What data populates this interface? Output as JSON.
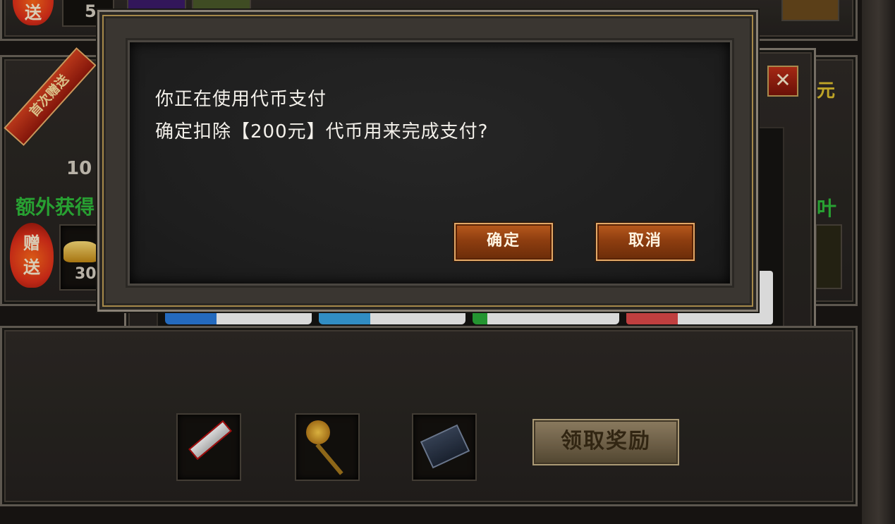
{
  "background": {
    "top_row": {
      "badge_label": "送",
      "count": "5"
    },
    "left_panel": {
      "ribbon_text": "首次赠送",
      "amount_partial": "10",
      "extra_label": "额外获得",
      "badge_label_top": "赠",
      "badge_label_bottom": "送",
      "slot_count": "30"
    },
    "right_edge": {
      "unit_partial": "元",
      "leaf_partial": "叶"
    },
    "payment_window": {
      "close_label": "✕"
    },
    "reward_button_label": "领取奖励"
  },
  "dialog": {
    "line1": "你正在使用代币支付",
    "line2": "确定扣除【200元】代币用来完成支付?",
    "confirm_label": "确定",
    "cancel_label": "取消"
  },
  "colors": {
    "accent_gold": "#a6894a",
    "button_orange": "#b95a1d",
    "green_text": "#2fbd3b",
    "yellow_text": "#e0c12e"
  }
}
